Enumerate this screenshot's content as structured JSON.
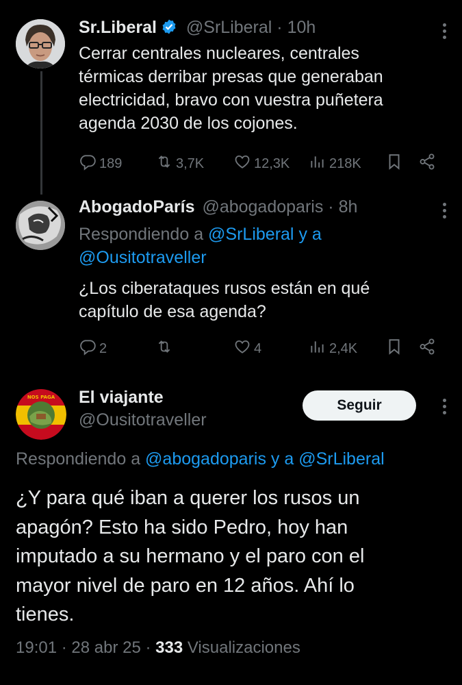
{
  "tweet1": {
    "name": "Sr.Liberal",
    "handle": "@SrLiberal",
    "time": "10h",
    "verified": true,
    "text_lines": [
      "Cerrar centrales nucleares, centrales",
      "térmicas derribar presas que generaban",
      "electricidad, bravo con vuestra puñetera",
      "agenda 2030 de los cojones."
    ],
    "replies": "189",
    "retweets": "3,7K",
    "likes": "12,3K",
    "views": "218K"
  },
  "tweet2": {
    "name": "AbogadoParís",
    "handle": "@abogadoparis",
    "time": "8h",
    "replying_prefix": "Respondiendo a",
    "replying_user1": "@SrLiberal",
    "replying_join": "y a",
    "replying_user2": "@Ousitotraveller",
    "text_lines": [
      "¿Los ciberataques rusos están en qué",
      "capítulo de esa agenda?"
    ],
    "replies": "2",
    "retweets": "",
    "likes": "4",
    "views": "2,4K"
  },
  "tweet3": {
    "name": "El viajante",
    "handle": "@Ousitotraveller",
    "follow_label": "Seguir",
    "avatar_text": "NOS PAGA DE ESPAÑA",
    "replying_prefix": "Respondiendo a",
    "replying_user1": "@abogadoparis",
    "replying_join": "y a",
    "replying_user2": "@SrLiberal",
    "text_lines": [
      "¿Y para qué iban a querer los rusos un",
      "apagón? Esto ha sido Pedro, hoy han",
      "imputado a su hermano y el paro con el",
      "mayor nivel de paro en 12 años. Ahí lo",
      "tienes."
    ],
    "timestamp": "19:01 · 28 abr 25 ·",
    "views_count": "333",
    "views_label": "Visualizaciones"
  },
  "colors": {
    "background": "#000000",
    "text": "#e7e9ea",
    "secondary": "#71767b",
    "link": "#1d9bf0",
    "verified": "#1d9bf0"
  },
  "icons": [
    "reply-icon",
    "retweet-icon",
    "like-icon",
    "views-icon",
    "bookmark-icon",
    "share-icon",
    "more-icon",
    "verified-badge-icon"
  ]
}
